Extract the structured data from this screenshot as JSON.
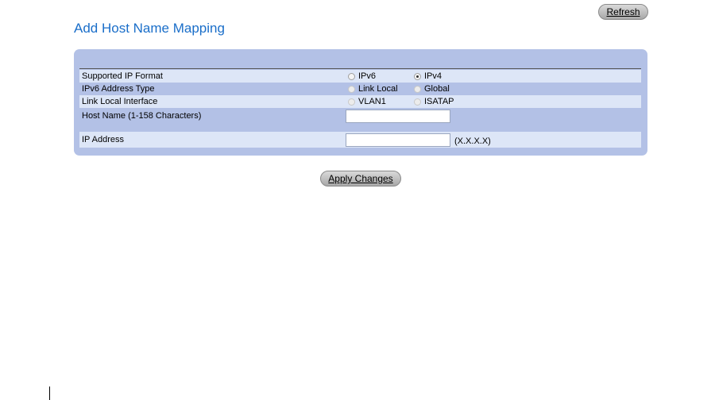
{
  "header": {
    "refresh_label": "Refresh",
    "title": "Add Host Name Mapping"
  },
  "form": {
    "supported_ip_format": {
      "label": "Supported IP Format",
      "options": [
        "IPv6",
        "IPv4"
      ],
      "selected": "IPv4"
    },
    "ipv6_address_type": {
      "label": "IPv6 Address Type",
      "options": [
        "Link Local",
        "Global"
      ]
    },
    "link_local_interface": {
      "label": "Link Local Interface",
      "options": [
        "VLAN1",
        "ISATAP"
      ]
    },
    "host_name": {
      "label": "Host Name (1-158 Characters)",
      "value": ""
    },
    "ip_address": {
      "label": "IP Address",
      "value": "",
      "hint": "(X.X.X.X)"
    }
  },
  "footer": {
    "apply_label": "Apply Changes"
  }
}
